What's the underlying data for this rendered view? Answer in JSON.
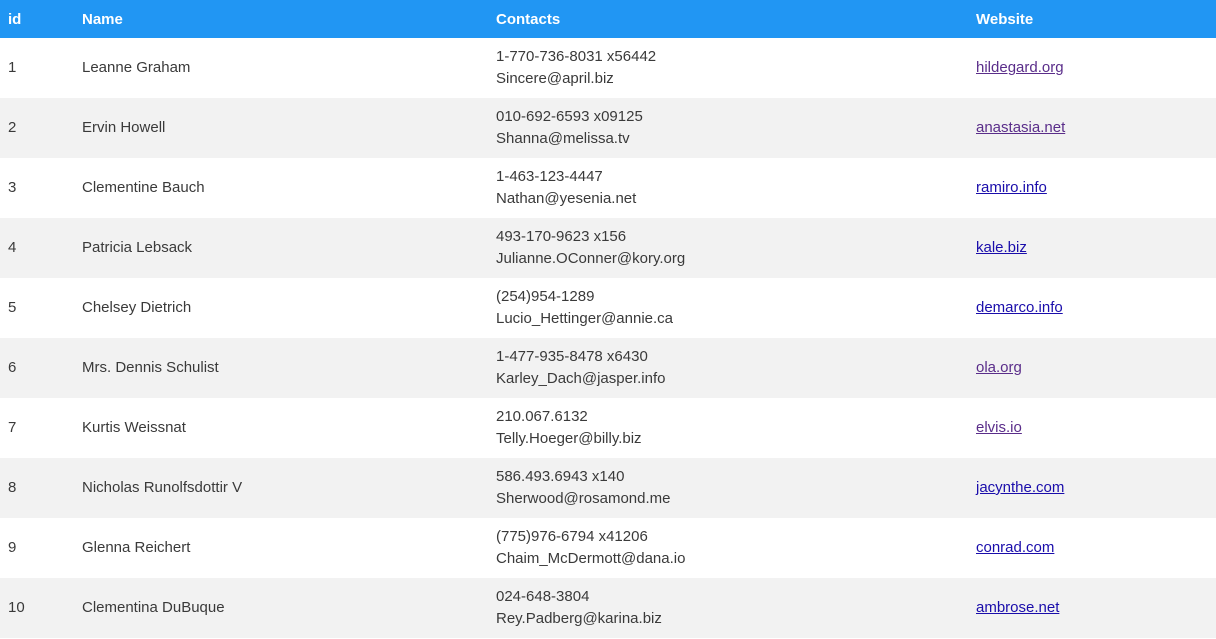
{
  "table": {
    "headers": {
      "id": "id",
      "name": "Name",
      "contacts": "Contacts",
      "website": "Website"
    },
    "rows": [
      {
        "id": "1",
        "name": "Leanne Graham",
        "phone": "1-770-736-8031 x56442",
        "email": "Sincere@april.biz",
        "website": "hildegard.org",
        "visited": true
      },
      {
        "id": "2",
        "name": "Ervin Howell",
        "phone": "010-692-6593 x09125",
        "email": "Shanna@melissa.tv",
        "website": "anastasia.net",
        "visited": true
      },
      {
        "id": "3",
        "name": "Clementine Bauch",
        "phone": "1-463-123-4447",
        "email": "Nathan@yesenia.net",
        "website": "ramiro.info",
        "visited": false
      },
      {
        "id": "4",
        "name": "Patricia Lebsack",
        "phone": "493-170-9623 x156",
        "email": "Julianne.OConner@kory.org",
        "website": "kale.biz",
        "visited": false
      },
      {
        "id": "5",
        "name": "Chelsey Dietrich",
        "phone": "(254)954-1289",
        "email": "Lucio_Hettinger@annie.ca",
        "website": "demarco.info",
        "visited": false
      },
      {
        "id": "6",
        "name": "Mrs. Dennis Schulist",
        "phone": "1-477-935-8478 x6430",
        "email": "Karley_Dach@jasper.info",
        "website": "ola.org",
        "visited": true
      },
      {
        "id": "7",
        "name": "Kurtis Weissnat",
        "phone": "210.067.6132",
        "email": "Telly.Hoeger@billy.biz",
        "website": "elvis.io",
        "visited": true
      },
      {
        "id": "8",
        "name": "Nicholas Runolfsdottir V",
        "phone": "586.493.6943 x140",
        "email": "Sherwood@rosamond.me",
        "website": "jacynthe.com",
        "visited": false
      },
      {
        "id": "9",
        "name": "Glenna Reichert",
        "phone": "(775)976-6794 x41206",
        "email": "Chaim_McDermott@dana.io",
        "website": "conrad.com",
        "visited": false
      },
      {
        "id": "10",
        "name": "Clementina DuBuque",
        "phone": "024-648-3804",
        "email": "Rey.Padberg@karina.biz",
        "website": "ambrose.net",
        "visited": false
      }
    ]
  },
  "colors": {
    "header_bg": "#2196f3",
    "header_text": "#ffffff",
    "stripe_bg": "#f2f2f2",
    "link": "#1a0dab",
    "link_visited": "#5a2d8a"
  }
}
